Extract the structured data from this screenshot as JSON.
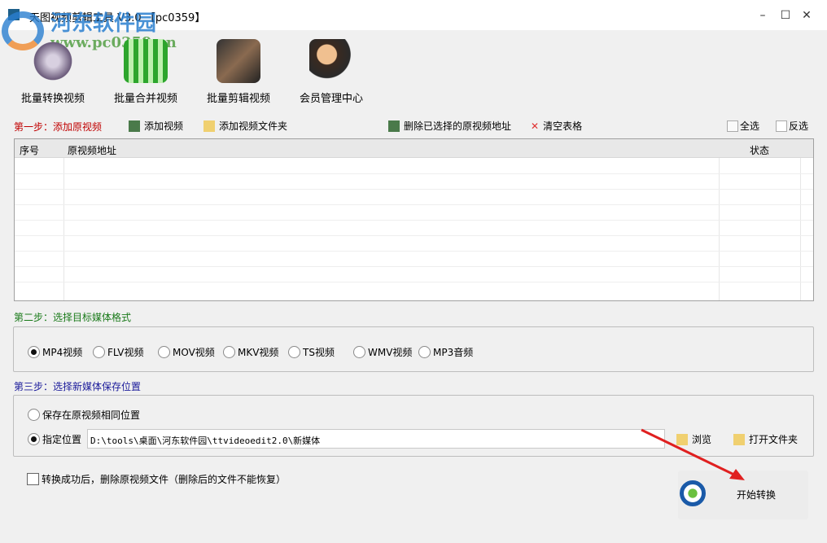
{
  "window": {
    "title": "天图视频剪辑工具 V3.0 【pc0359】",
    "minimize": "–",
    "maximize": "☐",
    "close": "✕"
  },
  "watermark": {
    "name": "河东软件园",
    "url": "www.pc0359.cn"
  },
  "toolbar": [
    {
      "label": "批量转换视频",
      "icon": "film-reel-convert-icon"
    },
    {
      "label": "批量合并视频",
      "icon": "merge-grid-icon"
    },
    {
      "label": "批量剪辑视频",
      "icon": "film-scissors-icon"
    },
    {
      "label": "会员管理中心",
      "icon": "users-icon"
    }
  ],
  "step1": {
    "label": "第一步：添加原视频",
    "add_video": "添加视频",
    "add_folder": "添加视频文件夹",
    "delete_selected": "删除已选择的原视频地址",
    "clear_table": "清空表格",
    "select_all": "全选",
    "invert": "反选"
  },
  "table": {
    "columns": [
      "序号",
      "原视频地址",
      "状态"
    ],
    "rows": []
  },
  "step2": {
    "label": "第二步：选择目标媒体格式",
    "formats": [
      "MP4视频",
      "FLV视频",
      "MOV视频",
      "MKV视频",
      "TS视频",
      "WMV视频",
      "MP3音频"
    ],
    "selected": "MP4视频"
  },
  "step3": {
    "label": "第三步：选择新媒体保存位置",
    "same_location": "保存在原视频相同位置",
    "custom_location": "指定位置",
    "path": "D:\\tools\\桌面\\河东软件园\\ttvideoedit2.0\\新媒体",
    "browse": "浏览",
    "open_folder": "打开文件夹"
  },
  "options": {
    "delete_after": "转换成功后，删除原视频文件（删除后的文件不能恢复）",
    "delete_after_checked": false
  },
  "start": {
    "label": "开始转换"
  },
  "colors": {
    "step1": "#c00000",
    "step2": "#1a7a1a",
    "step3": "#1a1a9a",
    "arrow": "#e02020"
  }
}
